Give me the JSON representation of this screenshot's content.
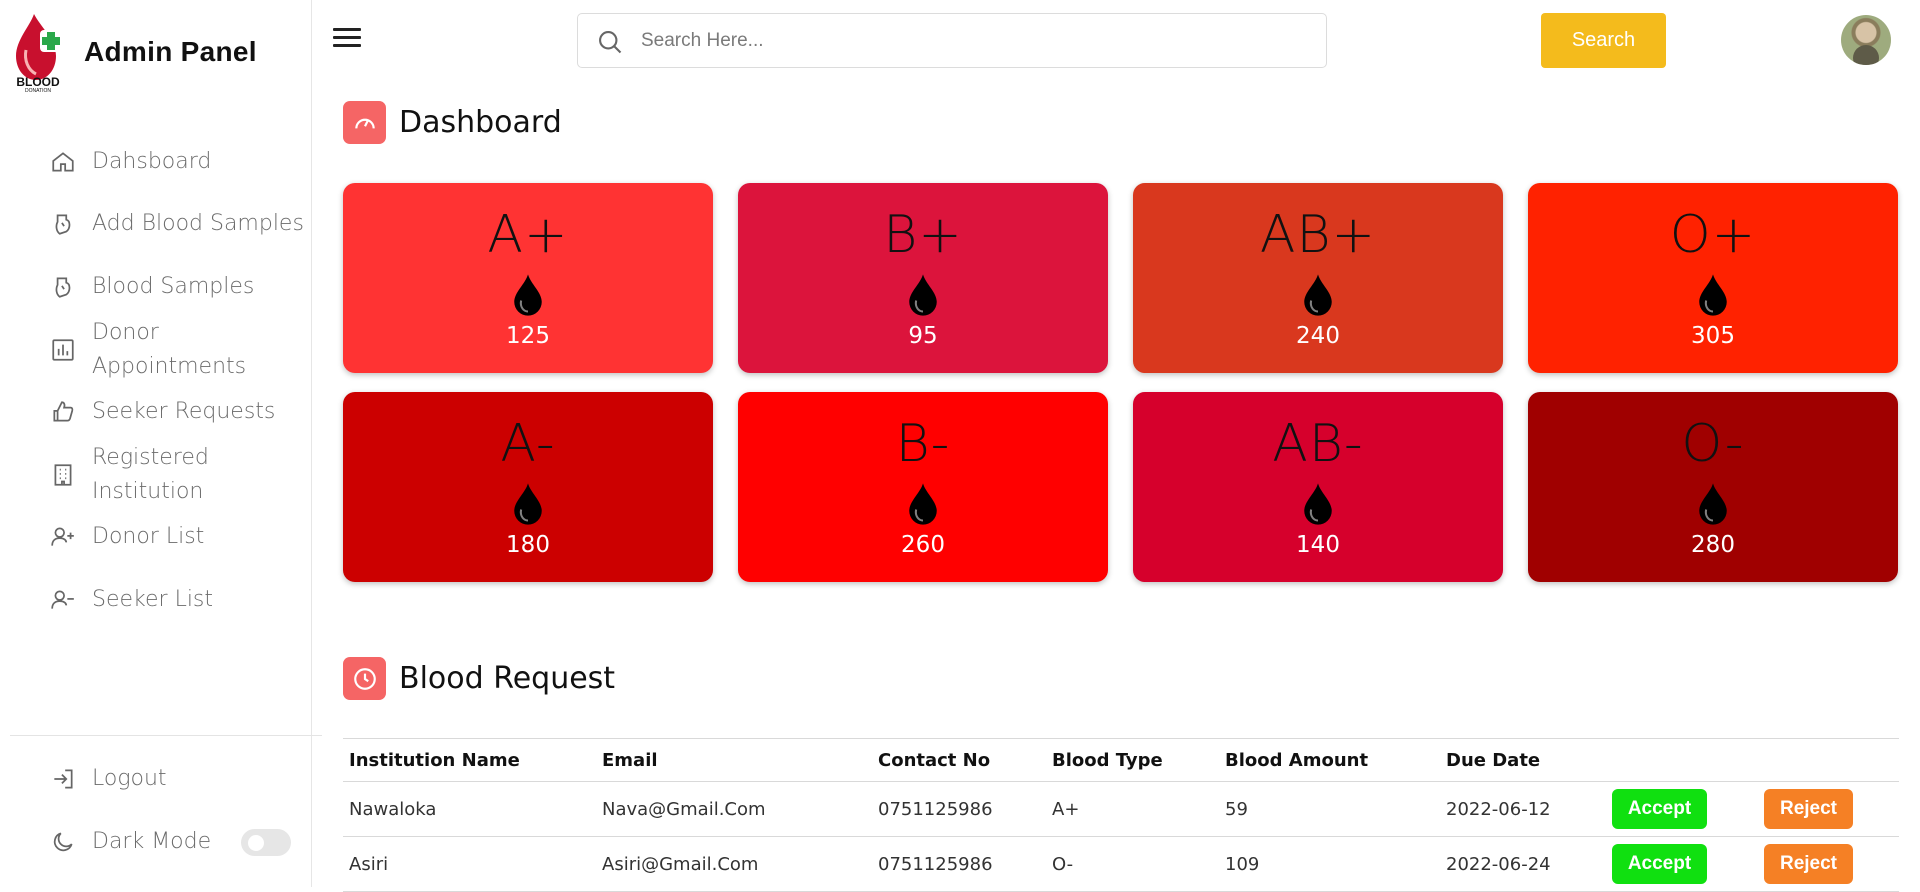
{
  "brand": {
    "logo_text": "BLOOD",
    "logo_subtext": "DONATION",
    "title": "Admin Panel"
  },
  "sidebar": {
    "items": [
      {
        "label": "Dahsboard",
        "icon": "home-icon"
      },
      {
        "label": "Add Blood Samples",
        "icon": "blood-bag-icon"
      },
      {
        "label": "Blood Samples",
        "icon": "blood-bag-icon"
      },
      {
        "label": "Donor Appointments",
        "icon": "bar-chart-icon"
      },
      {
        "label": "Seeker Requests",
        "icon": "thumbs-up-icon"
      },
      {
        "label": "Registered Institution",
        "icon": "building-icon"
      },
      {
        "label": "Donor List",
        "icon": "user-add-icon"
      },
      {
        "label": "Seeker List",
        "icon": "user-remove-icon"
      }
    ],
    "logout_label": "Logout",
    "dark_mode_label": "Dark Mode",
    "dark_mode_on": false
  },
  "header": {
    "search_placeholder": "Search Here...",
    "search_button": "Search"
  },
  "dashboard": {
    "title": "Dashboard",
    "cards": [
      {
        "group": "A+",
        "count": "125",
        "color": "#ff3333"
      },
      {
        "group": "B+",
        "count": "95",
        "color": "#dc143c"
      },
      {
        "group": "AB+",
        "count": "240",
        "color": "#d9381e"
      },
      {
        "group": "O+",
        "count": "305",
        "color": "#ff2200"
      },
      {
        "group": "A-",
        "count": "180",
        "color": "#cc0000"
      },
      {
        "group": "B-",
        "count": "260",
        "color": "#ff0000"
      },
      {
        "group": "AB-",
        "count": "140",
        "color": "#d6002c"
      },
      {
        "group": "O-",
        "count": "280",
        "color": "#a00000"
      }
    ]
  },
  "requests": {
    "title": "Blood Request",
    "columns": [
      "Institution Name",
      "Email",
      "Contact No",
      "Blood Type",
      "Blood Amount",
      "Due Date"
    ],
    "accept_label": "Accept",
    "reject_label": "Reject",
    "rows": [
      [
        "Nawaloka",
        "Nava@Gmail.Com",
        "0751125986",
        "A+",
        "59",
        "2022-06-12"
      ],
      [
        "Asiri",
        "Asiri@Gmail.Com",
        "0751125986",
        "O-",
        "109",
        "2022-06-24"
      ]
    ]
  },
  "colors": {
    "accent_red": "#f56565",
    "search_button": "#f4bb1c",
    "accept": "#10e010",
    "reject": "#f58025"
  }
}
